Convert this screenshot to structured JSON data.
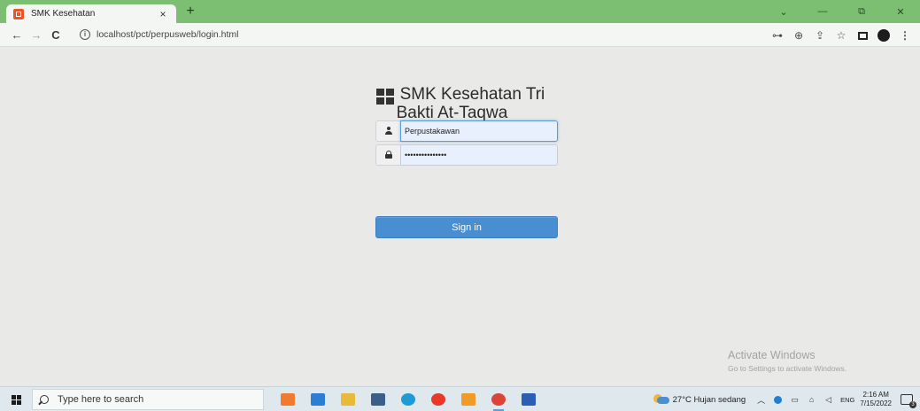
{
  "browser": {
    "tab_title": "SMK Kesehatan",
    "tab_close": "×",
    "new_tab": "+",
    "url": "localhost/pct/perpusweb/login.html",
    "window_buttons": [
      "⌄",
      "—",
      "⧉",
      "✕"
    ]
  },
  "login": {
    "brand_line1": "SMK Kesehatan Tri",
    "brand_line2": "Bakti At-Taqwa",
    "username_value": "Perpustakawan",
    "password_value": "•••••••••••••••",
    "signin_label": "Sign in"
  },
  "watermark": {
    "title": "Activate Windows",
    "subtitle": "Go to Settings to activate Windows."
  },
  "taskbar": {
    "search_placeholder": "Type here to search",
    "apps": [
      {
        "icon": "xampp-icon",
        "color": "#f07a2e"
      },
      {
        "icon": "mail-icon",
        "color": "#2a7fd4"
      },
      {
        "icon": "file-explorer-icon",
        "color": "#e9b93a"
      },
      {
        "icon": "calculator-icon",
        "color": "#3b5f8a"
      },
      {
        "icon": "edge-icon",
        "color": "#1e9ad6"
      },
      {
        "icon": "opera-icon",
        "color": "#e8382b"
      },
      {
        "icon": "sublime-icon",
        "color": "#f29a26"
      },
      {
        "icon": "chrome-icon",
        "color": "#db4437"
      },
      {
        "icon": "word-icon",
        "color": "#2b5fb4"
      }
    ],
    "weather": "27°C  Hujan sedang",
    "language": "ENG",
    "time": "2:16 AM",
    "date": "7/15/2022"
  },
  "colors": {
    "tab_strip": "#7cbf72",
    "signin_button": "#4a8ed2",
    "input_bg": "#e8f0fe"
  }
}
